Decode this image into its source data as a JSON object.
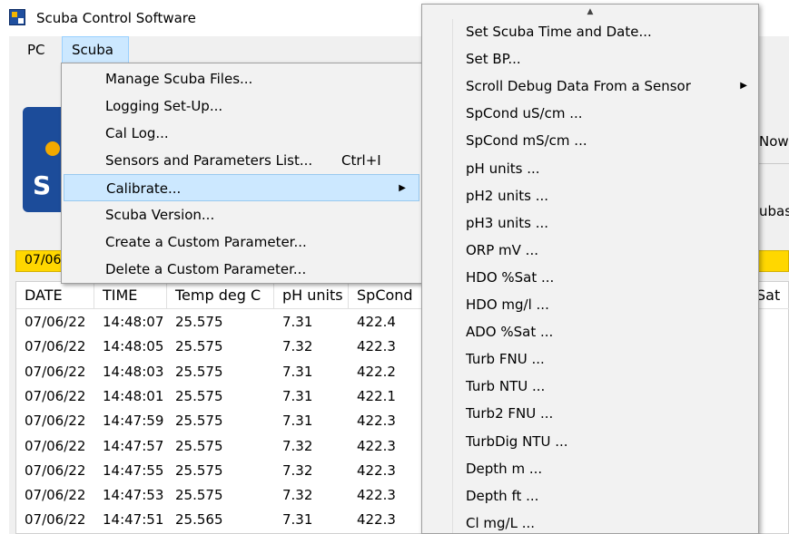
{
  "window": {
    "title": "Scuba Control Software",
    "icon": "scuba-app-icon"
  },
  "menubar": {
    "items": [
      "PC",
      "Scuba"
    ],
    "active": "Scuba"
  },
  "background": {
    "logo_letter": "S",
    "right_text_1": "Now",
    "right_text_2": "ubas",
    "status_date": "07/06",
    "status_color": "#ffd700"
  },
  "table": {
    "columns": [
      "DATE",
      "TIME",
      "Temp deg C",
      "pH units",
      "SpCond"
    ],
    "right_column_fragment": "Sat",
    "rows": [
      [
        "07/06/22",
        "14:48:07",
        "25.575",
        "7.31",
        "422.4"
      ],
      [
        "07/06/22",
        "14:48:05",
        "25.575",
        "7.32",
        "422.3"
      ],
      [
        "07/06/22",
        "14:48:03",
        "25.575",
        "7.31",
        "422.2"
      ],
      [
        "07/06/22",
        "14:48:01",
        "25.575",
        "7.31",
        "422.1"
      ],
      [
        "07/06/22",
        "14:47:59",
        "25.575",
        "7.31",
        "422.3"
      ],
      [
        "07/06/22",
        "14:47:57",
        "25.575",
        "7.32",
        "422.3"
      ],
      [
        "07/06/22",
        "14:47:55",
        "25.575",
        "7.32",
        "422.3"
      ],
      [
        "07/06/22",
        "14:47:53",
        "25.575",
        "7.32",
        "422.3"
      ],
      [
        "07/06/22",
        "14:47:51",
        "25.565",
        "7.31",
        "422.3"
      ]
    ]
  },
  "scuba_menu": {
    "items": [
      {
        "label": "Manage Scuba Files...",
        "shortcut": ""
      },
      {
        "label": "Logging Set-Up...",
        "shortcut": ""
      },
      {
        "label": "Cal Log...",
        "shortcut": ""
      },
      {
        "label": "Sensors and Parameters List...",
        "shortcut": "Ctrl+I"
      },
      {
        "label": "Calibrate...",
        "shortcut": "",
        "submenu": true,
        "active": true
      },
      {
        "label": "Scuba Version...",
        "shortcut": ""
      },
      {
        "label": "Create a Custom Parameter...",
        "shortcut": ""
      },
      {
        "label": "Delete a Custom Parameter...",
        "shortcut": ""
      }
    ],
    "highlight_color": "#cce8ff"
  },
  "calibrate_menu": {
    "items": [
      {
        "label": "Set Scuba Time and Date..."
      },
      {
        "label": "Set BP..."
      },
      {
        "label": "Scroll Debug Data From a Sensor",
        "submenu": true
      },
      {
        "label": "SpCond uS/cm ..."
      },
      {
        "label": "SpCond mS/cm ..."
      },
      {
        "label": "pH units ..."
      },
      {
        "label": "pH2 units ..."
      },
      {
        "label": "pH3 units ..."
      },
      {
        "label": "ORP mV ..."
      },
      {
        "label": "HDO %Sat ..."
      },
      {
        "label": "HDO mg/l ..."
      },
      {
        "label": "ADO %Sat ..."
      },
      {
        "label": "Turb FNU ..."
      },
      {
        "label": "Turb NTU ..."
      },
      {
        "label": "Turb2 FNU ..."
      },
      {
        "label": "TurbDig NTU ..."
      },
      {
        "label": "Depth m ..."
      },
      {
        "label": "Depth ft ..."
      },
      {
        "label": "Cl mg/L ..."
      }
    ],
    "scroll_up_icon": "scroll-up-arrow-icon"
  }
}
